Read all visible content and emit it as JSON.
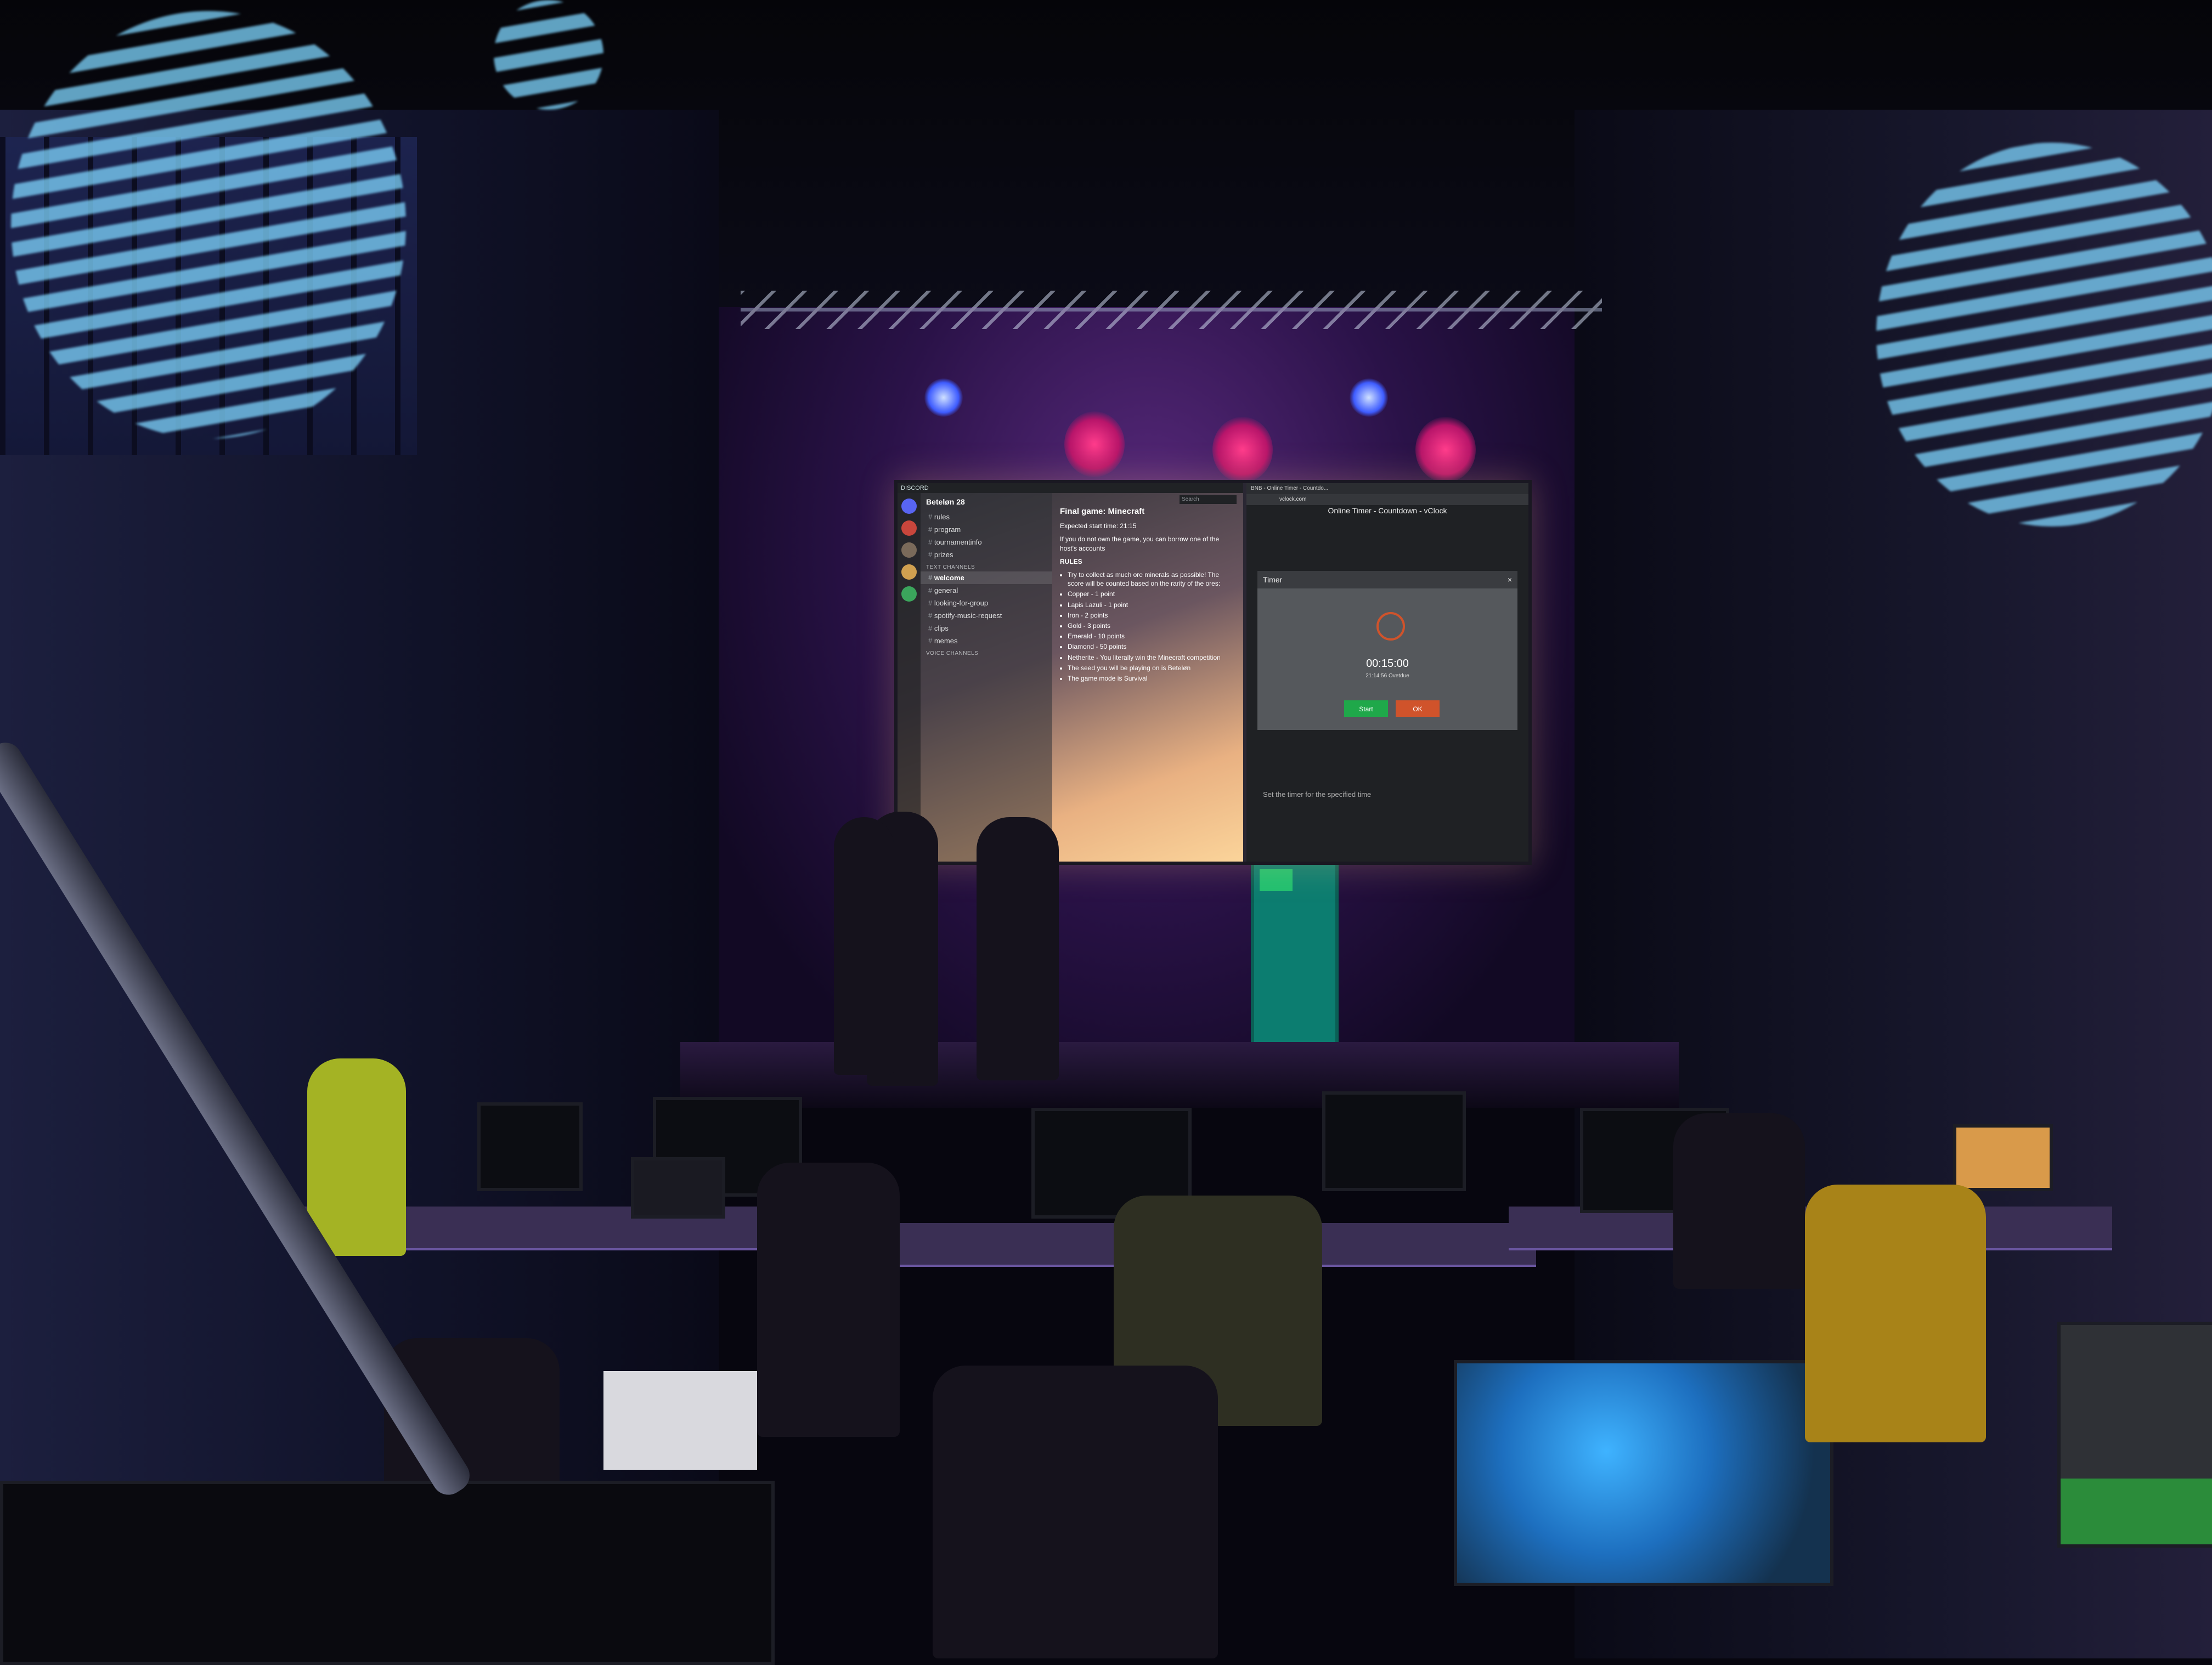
{
  "discord": {
    "window_title": "DISCORD",
    "server_name": "Beteløn 28",
    "search_placeholder": "Search",
    "channels_top": [
      "rules",
      "program",
      "tournamentinfo",
      "prizes"
    ],
    "text_category": "TEXT CHANNELS",
    "text_channels": [
      "welcome",
      "general",
      "looking-for-group",
      "spotify-music-request",
      "clips",
      "memes"
    ],
    "voice_category": "VOICE CHANNELS",
    "active_channel": "welcome"
  },
  "announcement": {
    "heading": "Final game: Minecraft",
    "start_time": "Expected start time: 21:15",
    "note": "If you do not own the game, you can borrow one of the host's accounts",
    "rules_label": "RULES",
    "rules": [
      "Try to collect as much ore minerals as possible! The score will be counted based on the rarity of the ores:",
      "Copper - 1 point",
      "Lapis Lazuli - 1 point",
      "Iron - 2 points",
      "Gold - 3 points",
      "Emerald - 10 points",
      "Diamond - 50 points",
      "Netherite - You literally win the Minecraft competition",
      "The seed you will be playing on is Beteløn",
      "The game mode is Survival"
    ]
  },
  "browser": {
    "tab_title": "BNB - Online Timer - Countdo...",
    "url": "vclock.com",
    "page_title": "Online Timer - Countdown - vClock"
  },
  "timer": {
    "panel_title": "Timer",
    "close_glyph": "×",
    "time_display": "00:15:00",
    "sub_text": "21:14:56 Ovetdue",
    "start_label": "Start",
    "ok_label": "OK",
    "description": "Set the timer for the specified time"
  },
  "colors": {
    "discord_bg": "#2f3136",
    "start_button": "#1fa84a",
    "ok_button": "#d0532b",
    "stage_light_pink": "#ff3c8c",
    "stage_light_blue": "#3e5cff",
    "pattern_light": "#7fd6ff"
  }
}
